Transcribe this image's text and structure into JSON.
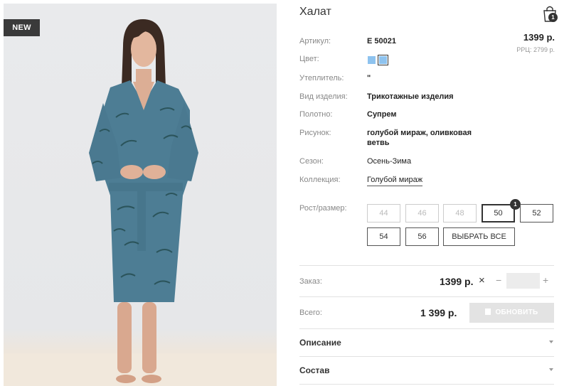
{
  "badge": "NEW",
  "product": {
    "title": "Халат",
    "price": "1399 р.",
    "rrp": "РРЦ: 2799 р."
  },
  "cart": {
    "count": "1",
    "icon": "shopping-bag-icon"
  },
  "properties": {
    "article": {
      "label": "Артикул:",
      "value": "Е 50021"
    },
    "color": {
      "label": "Цвет:",
      "swatches": [
        "#8ec3ef",
        "#8ec3ef"
      ],
      "selected_index": 1
    },
    "insulation": {
      "label": "Утеплитель:",
      "value": "\""
    },
    "type": {
      "label": "Вид изделия:",
      "value": "Трикотажные изделия"
    },
    "fabric": {
      "label": "Полотно:",
      "value": "Супрем"
    },
    "pattern": {
      "label": "Рисунок:",
      "value_line1": "голубой мираж, оливковая",
      "value_line2": "ветвь"
    },
    "season": {
      "label": "Сезон:",
      "value": "Осень-Зима"
    },
    "collection": {
      "label": "Коллекция:",
      "value": "Голубой мираж"
    }
  },
  "sizes": {
    "label": "Рост/размер:",
    "items": [
      {
        "label": "44",
        "state": "disabled"
      },
      {
        "label": "46",
        "state": "disabled"
      },
      {
        "label": "48",
        "state": "disabled"
      },
      {
        "label": "50",
        "state": "selected",
        "count": "1"
      },
      {
        "label": "52",
        "state": "available"
      },
      {
        "label": "54",
        "state": "available"
      },
      {
        "label": "56",
        "state": "available"
      }
    ],
    "select_all": "ВЫБРАТЬ ВСЕ"
  },
  "order": {
    "label": "Заказ:",
    "price": "1399 р.",
    "times": "×",
    "minus": "−",
    "plus": "+",
    "quantity": ""
  },
  "total": {
    "label": "Всего:",
    "value": "1 399 р.",
    "button": "ОБНОВИТЬ"
  },
  "accordion": {
    "description": "Описание",
    "composition": "Состав"
  }
}
